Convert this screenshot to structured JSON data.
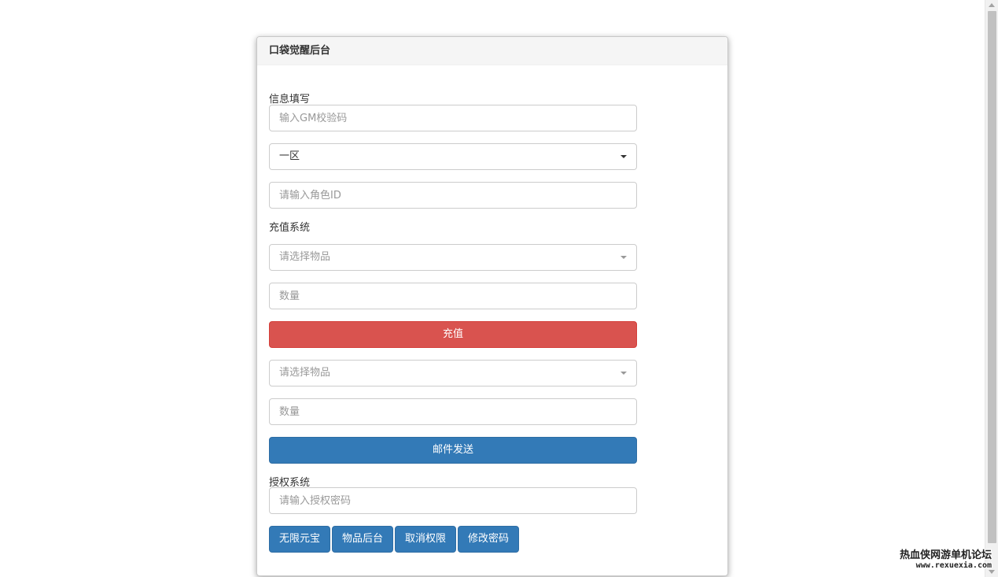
{
  "panel": {
    "title": "口袋觉醒后台"
  },
  "info_section": {
    "label": "信息填写",
    "gm_code_placeholder": "输入GM校验码",
    "server_select_value": "一区",
    "role_id_placeholder": "请输入角色ID"
  },
  "recharge_section": {
    "label": "充值系统",
    "item_select_placeholder": "请选择物品",
    "quantity_placeholder": "数量",
    "recharge_button": "充值"
  },
  "mail_section": {
    "item_select_placeholder": "请选择物品",
    "quantity_placeholder": "数量",
    "send_button": "邮件发送"
  },
  "auth_section": {
    "label": "授权系统",
    "password_placeholder": "请输入授权密码",
    "buttons": [
      "无限元宝",
      "物品后台",
      "取消权限",
      "修改密码"
    ]
  },
  "watermark": {
    "title": "热血侠网游单机论坛",
    "url": "www.rexuexia.com"
  },
  "colors": {
    "danger": "#d9534f",
    "primary": "#337ab7",
    "heading_bg": "#f5f5f5"
  },
  "icons": {
    "dropdown": "caret-down-icon"
  }
}
